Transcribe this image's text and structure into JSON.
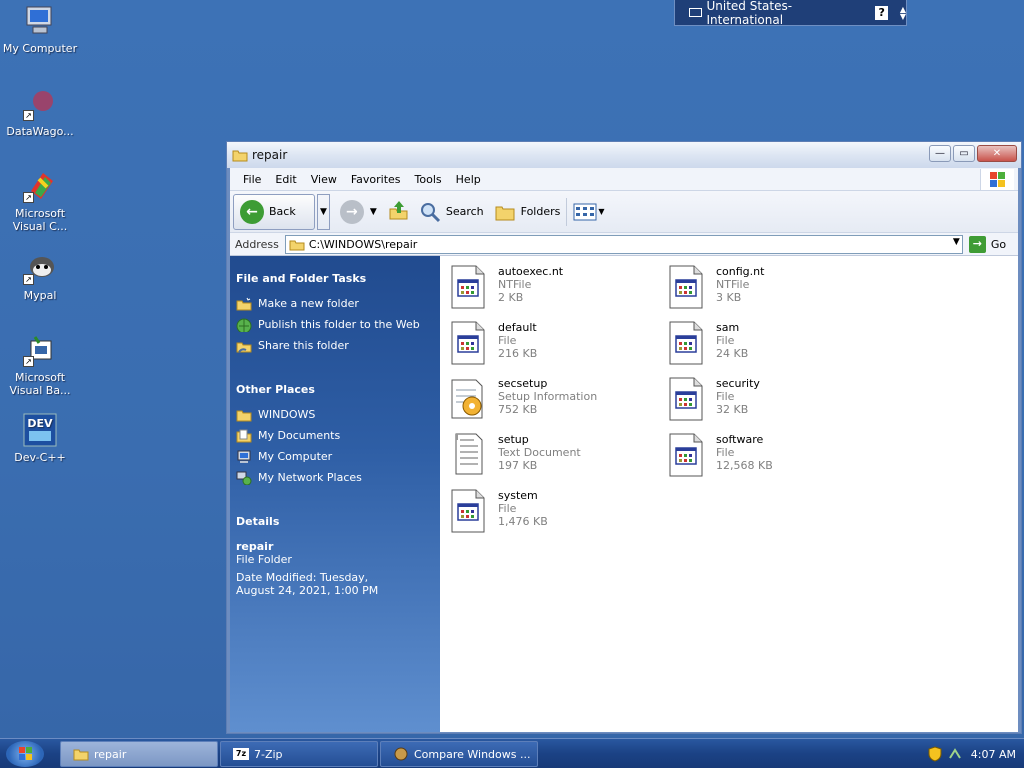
{
  "desktop": {
    "icons": [
      {
        "label": "My Computer"
      },
      {
        "label": "DataWago..."
      },
      {
        "label": "Microsoft Visual C..."
      },
      {
        "label": "Mypal"
      },
      {
        "label": "Microsoft Visual Ba..."
      },
      {
        "label": "Dev-C++"
      }
    ]
  },
  "langbar": {
    "language": "United States-International",
    "help": "?"
  },
  "window": {
    "title": "repair",
    "menu": [
      "File",
      "Edit",
      "View",
      "Favorites",
      "Tools",
      "Help"
    ],
    "toolbar": {
      "back": "Back",
      "search": "Search",
      "folders": "Folders"
    },
    "address": {
      "label": "Address",
      "path": "C:\\WINDOWS\\repair",
      "go": "Go"
    },
    "taskpane": {
      "file_tasks_title": "File and Folder Tasks",
      "file_tasks": [
        "Make a new folder",
        "Publish this folder to the Web",
        "Share this folder"
      ],
      "other_places_title": "Other Places",
      "other_places": [
        "WINDOWS",
        "My Documents",
        "My Computer",
        "My Network Places"
      ],
      "details_title": "Details",
      "details_name": "repair",
      "details_type": "File Folder",
      "details_modified": "Date Modified: Tuesday, August 24, 2021, 1:00 PM"
    },
    "files": [
      {
        "name": "autoexec.nt",
        "type": "NTFile",
        "size": "2 KB",
        "icon": "system-file-icon"
      },
      {
        "name": "config.nt",
        "type": "NTFile",
        "size": "3 KB",
        "icon": "system-file-icon"
      },
      {
        "name": "default",
        "type": "File",
        "size": "216 KB",
        "icon": "system-file-icon"
      },
      {
        "name": "sam",
        "type": "File",
        "size": "24 KB",
        "icon": "system-file-icon"
      },
      {
        "name": "secsetup",
        "type": "Setup Information",
        "size": "752 KB",
        "icon": "setup-info-icon"
      },
      {
        "name": "security",
        "type": "File",
        "size": "32 KB",
        "icon": "system-file-icon"
      },
      {
        "name": "setup",
        "type": "Text Document",
        "size": "197 KB",
        "icon": "text-document-icon"
      },
      {
        "name": "software",
        "type": "File",
        "size": "12,568 KB",
        "icon": "system-file-icon"
      },
      {
        "name": "system",
        "type": "File",
        "size": "1,476 KB",
        "icon": "system-file-icon"
      }
    ]
  },
  "taskbar": {
    "tasks": [
      "repair",
      "7-Zip",
      "Compare Windows ..."
    ],
    "clock": "4:07 AM"
  }
}
